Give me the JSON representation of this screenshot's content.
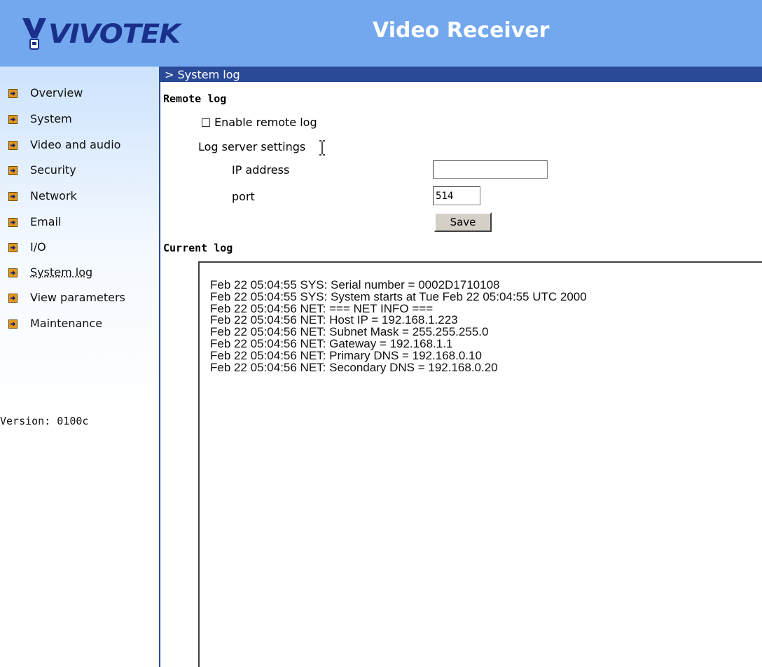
{
  "header": {
    "logo_text": "VIVOTEK",
    "product_title": "Video Receiver",
    "bg_color": "#73a8ee"
  },
  "sidebar": {
    "items": [
      {
        "label": "Overview",
        "icon": "arrow-right-icon"
      },
      {
        "label": "System",
        "icon": "arrow-right-icon"
      },
      {
        "label": "Video and audio",
        "icon": "arrow-right-icon"
      },
      {
        "label": "Security",
        "icon": "arrow-right-icon"
      },
      {
        "label": "Network",
        "icon": "arrow-right-icon"
      },
      {
        "label": "Email",
        "icon": "arrow-right-icon"
      },
      {
        "label": "I/O",
        "icon": "arrow-right-icon"
      },
      {
        "label": "System log",
        "icon": "arrow-right-icon",
        "active": true
      },
      {
        "label": "View parameters",
        "icon": "arrow-right-icon"
      },
      {
        "label": "Maintenance",
        "icon": "arrow-right-icon"
      }
    ],
    "version": "Version: 0100c"
  },
  "main": {
    "section_title": "> System log",
    "accent_color": "#2a4a97",
    "remote_log": {
      "heading": "Remote log",
      "enable_label": "Enable remote log",
      "enable_checked": false,
      "server_settings_label": "Log server settings",
      "ip_label": "IP address",
      "ip_value": "",
      "port_label": "port",
      "port_value": "514",
      "save_label": "Save"
    },
    "current_log": {
      "heading": "Current log",
      "text": "Feb 22 05:04:55 SYS: Serial number = 0002D1710108\nFeb 22 05:04:55 SYS: System starts at Tue Feb 22 05:04:55 UTC 2000\nFeb 22 05:04:56 NET: === NET INFO ===\nFeb 22 05:04:56 NET: Host IP = 192.168.1.223\nFeb 22 05:04:56 NET: Subnet Mask = 255.255.255.0\nFeb 22 05:04:56 NET: Gateway = 192.168.1.1\nFeb 22 05:04:56 NET: Primary DNS = 192.168.0.10\nFeb 22 05:04:56 NET: Secondary DNS = 192.168.0.20"
    }
  }
}
